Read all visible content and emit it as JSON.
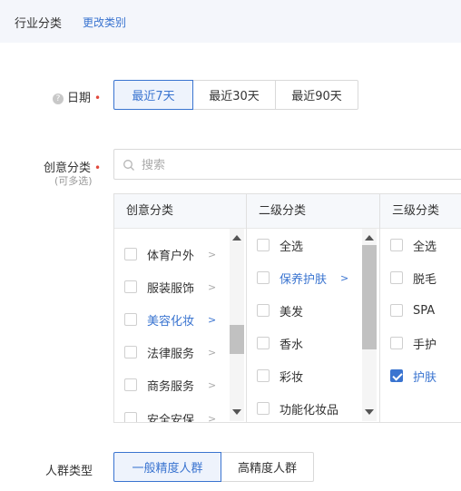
{
  "header": {
    "title": "行业分类",
    "change_link": "更改类别"
  },
  "date": {
    "label": "日期",
    "required_mark": "•",
    "options": [
      "最近7天",
      "最近30天",
      "最近90天"
    ],
    "selected": "最近7天"
  },
  "creative": {
    "label": "创意分类",
    "required_mark": "•",
    "sublabel": "(可多选)",
    "search_placeholder": "搜索",
    "columns": {
      "level1": {
        "header": "创意分类",
        "items": [
          "体育户外",
          "服装服饰",
          "美容化妆",
          "法律服务",
          "商务服务",
          "安全安保"
        ],
        "selected": "美容化妆",
        "scroll_fraction": 0.75
      },
      "level2": {
        "header": "二级分类",
        "items": [
          "全选",
          "保养护肤",
          "美发",
          "香水",
          "彩妆",
          "功能化妆品"
        ],
        "selected": "保养护肤",
        "scroll_fraction": 0.0
      },
      "level3": {
        "header": "三级分类",
        "items": [
          "全选",
          "脱毛",
          "SPA",
          "手护",
          "护肤"
        ],
        "checked": [
          "护肤"
        ]
      }
    }
  },
  "audience": {
    "label": "人群类型",
    "options": [
      "一般精度人群",
      "高精度人群"
    ],
    "selected": "一般精度人群"
  },
  "colors": {
    "accent": "#3a74d0",
    "required": "#e2483b",
    "header_bg": "#f4f6fb"
  }
}
